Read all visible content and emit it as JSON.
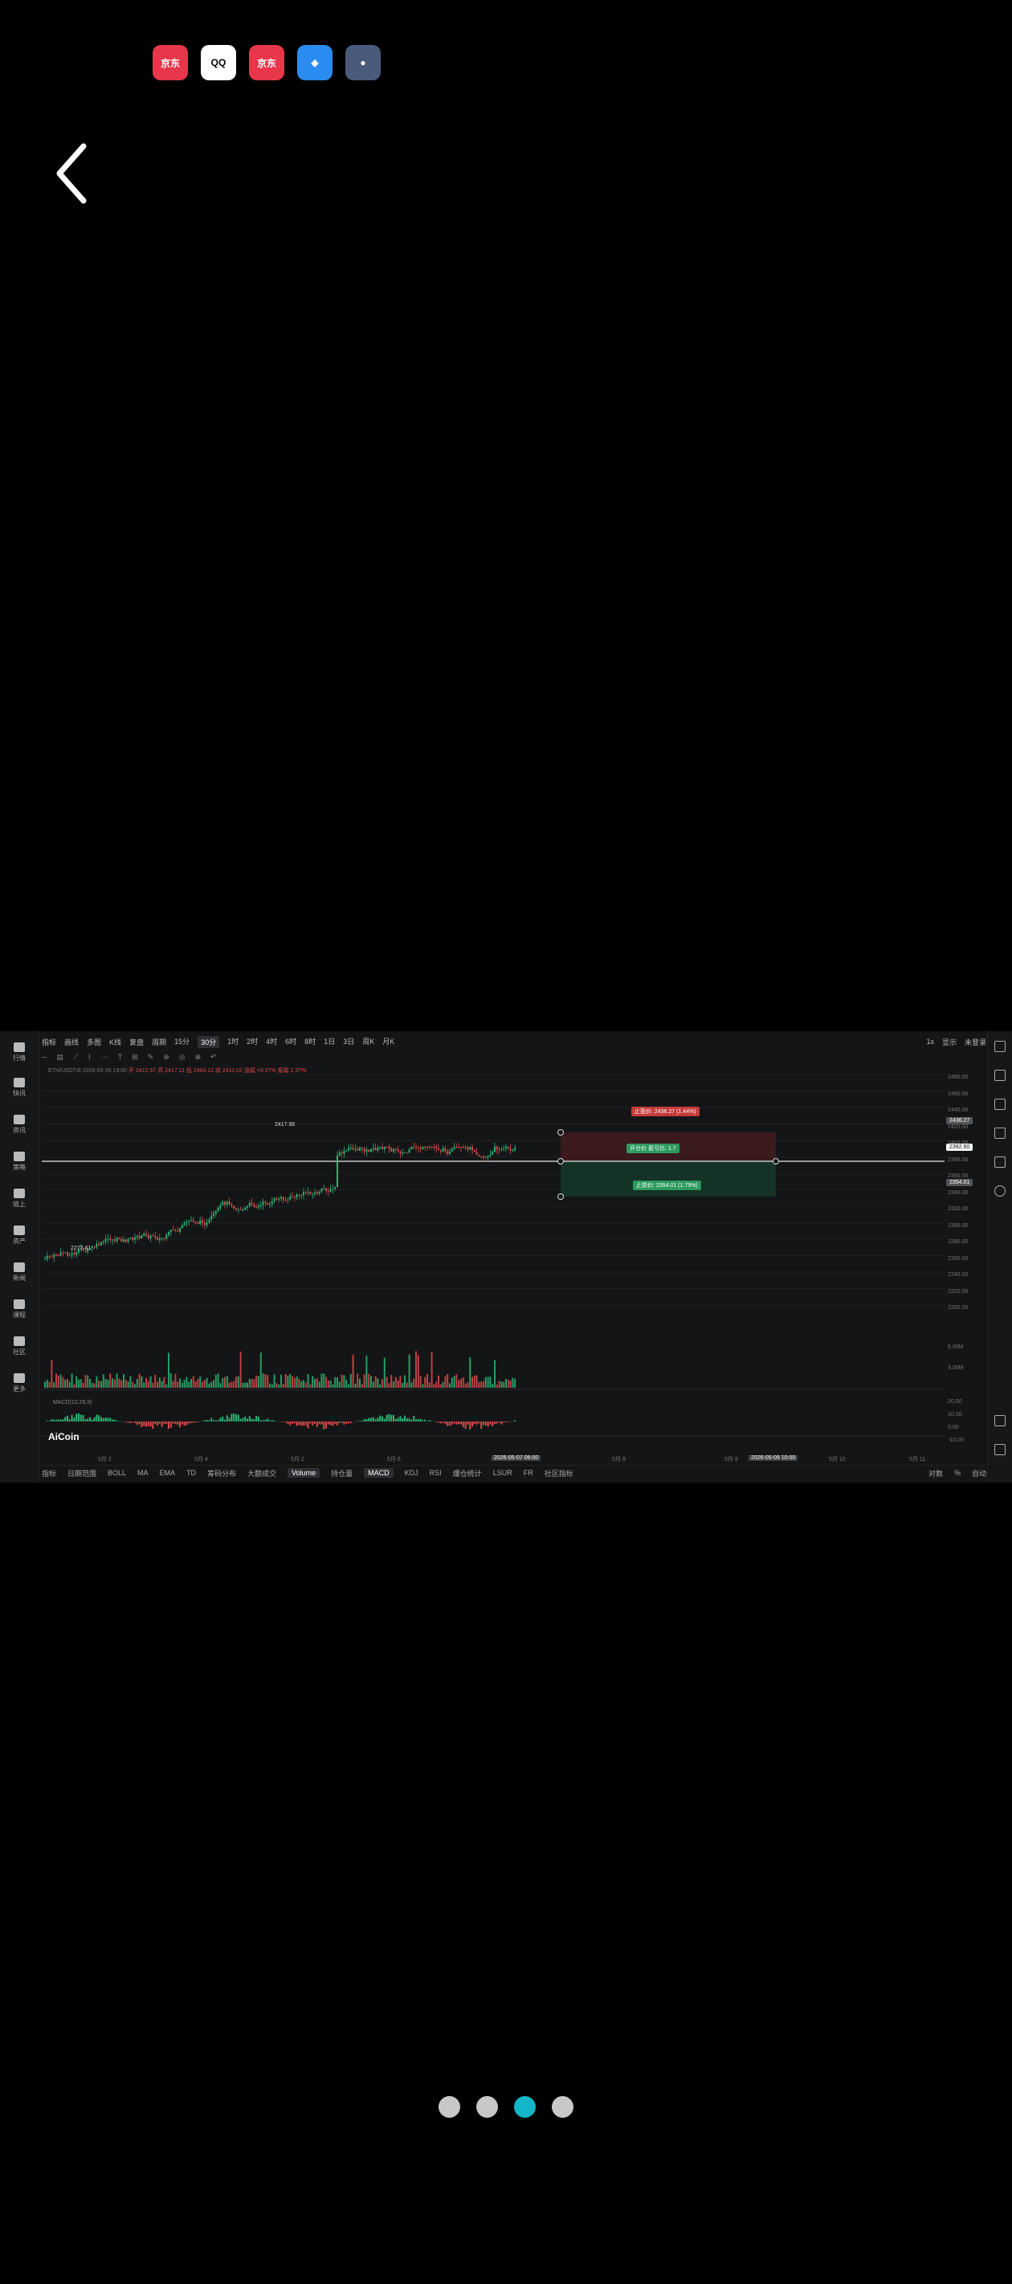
{
  "colors": {
    "up": "#2cb472",
    "down": "#d84a4a",
    "accent": "#13b7c9"
  },
  "status_apps": [
    "jd-app",
    "qq-app",
    "jd-app",
    "browser-app",
    "game-app"
  ],
  "nav": {
    "back_icon": "chevron-left-icon"
  },
  "chart_app": {
    "left_nav": [
      {
        "label": "行情"
      },
      {
        "label": "快讯"
      },
      {
        "label": "资讯"
      },
      {
        "label": "策略"
      },
      {
        "label": "链上"
      },
      {
        "label": "资产"
      },
      {
        "label": "新闻"
      },
      {
        "label": "课程"
      },
      {
        "label": "社区"
      },
      {
        "label": "更多"
      }
    ],
    "topbar": {
      "items": [
        "指标",
        "画线",
        "多图",
        "K线",
        "复盘",
        "周期"
      ],
      "intervals": [
        "15分",
        "30分",
        "1时",
        "2时",
        "4时",
        "6时",
        "8时",
        "1日",
        "3日",
        "周K",
        "月K"
      ],
      "selected_interval": "30分",
      "right_items": [
        "1x",
        "显示",
        "未登录"
      ]
    },
    "infoline": {
      "symbol": "ETH/USDT.B",
      "datetime": "2026-05-26 19:00",
      "open": "开 2412.67",
      "high": "高 2417.11",
      "low": "低 2404.12",
      "close": "收 2411.02",
      "change": "涨幅 +0.37%",
      "amplitude": "振幅 2.37%"
    },
    "annotations": {
      "high_label": "2417.96",
      "low_label": "2277.41",
      "tp_label": "止盈价: 2436.27 (1.44%)",
      "entry_label": "开仓价 盈亏比: 1.7",
      "sl_label": "止损价: 2354.01 (1.79%)",
      "current_price": "2392.60",
      "tp_price": "2436.27",
      "sl_price": "2354.01"
    },
    "price_axis": [
      "2480.00",
      "2460.00",
      "2440.00",
      "2420.00",
      "2400.00",
      "2380.00",
      "2360.00",
      "2340.00",
      "2320.00",
      "2300.00",
      "2280.00",
      "2260.00",
      "2240.00",
      "2220.00",
      "2200.00"
    ],
    "volume_axis": [
      "6.00M",
      "3.00M"
    ],
    "macd_axis": [
      "20.00",
      "10.00",
      "0.00",
      "-10.00"
    ],
    "indicator_label": "MACD(12,26,9)",
    "time_axis": [
      "5月 2",
      "5月 4",
      "5月 2",
      "5月 6",
      "2026-05-07 06:00",
      "5月 8",
      "5月 9",
      "2026-05-09 10:00",
      "5月 10",
      "5月 11"
    ],
    "bottom_bar": [
      "指标",
      "日期范围",
      "BOLL",
      "MA",
      "EMA",
      "TD",
      "筹码分布",
      "大额成交",
      "Volume",
      "持仓量",
      "MACD",
      "KDJ",
      "RSI",
      "爆仓统计",
      "LSUR",
      "FR",
      "社区指标"
    ],
    "bottom_active": [
      "Volume",
      "MACD"
    ],
    "bottom_right": [
      "对数",
      "%",
      "自动"
    ],
    "logo": "AiCoin"
  },
  "pager": {
    "count": 4,
    "active_index": 2
  }
}
